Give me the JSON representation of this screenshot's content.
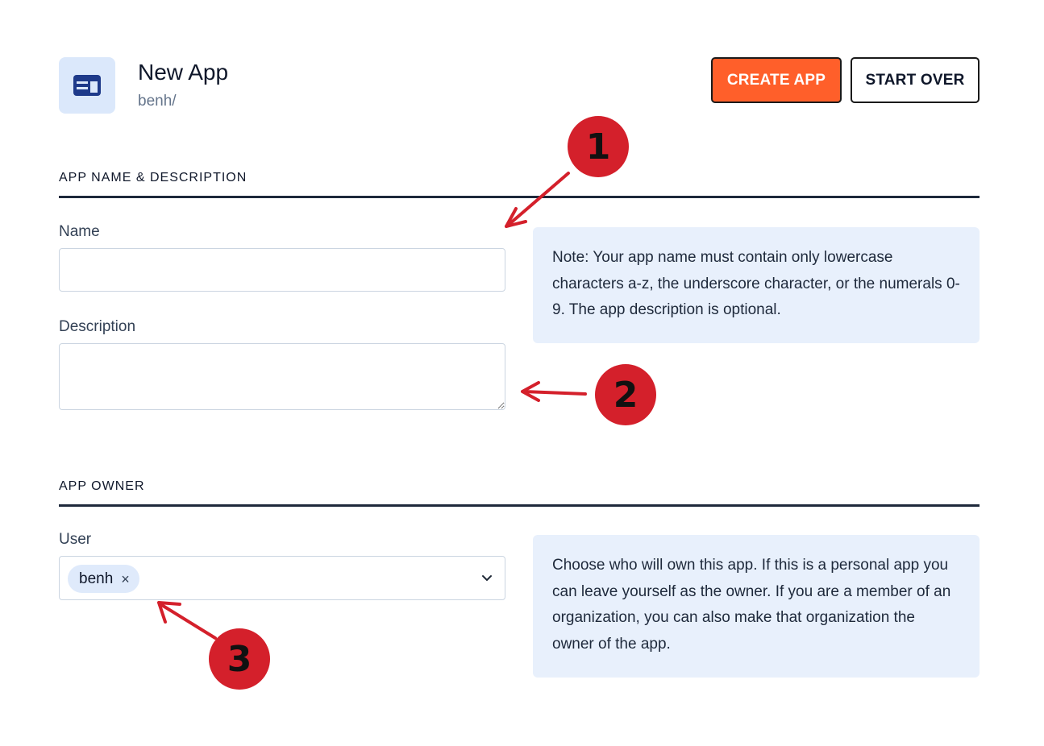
{
  "header": {
    "title": "New App",
    "subtitle": "benh/",
    "create_button": "CREATE APP",
    "start_over_button": "START OVER"
  },
  "section_name": {
    "heading": "APP NAME & DESCRIPTION",
    "name_label": "Name",
    "name_value": "",
    "description_label": "Description",
    "description_value": "",
    "note": "Note: Your app name must contain only lowercase characters a-z, the underscore character, or the numerals 0-9. The app description is optional."
  },
  "section_owner": {
    "heading": "APP OWNER",
    "user_label": "User",
    "selected_user": "benh",
    "remove_symbol": "×",
    "note": "Choose who will own this app. If this is a personal app you can leave yourself as the owner. If you are a member of an organization, you can also make that organization the owner of the app."
  },
  "annotations": [
    "1",
    "2",
    "3"
  ],
  "colors": {
    "accent": "#ff5f2a",
    "icon_bg": "#dbe8fb",
    "note_bg": "#e8f0fc",
    "annotation_red": "#d4202b"
  },
  "icons": {
    "app": "app-window-icon",
    "chevron": "chevron-down-icon",
    "remove": "close-icon"
  }
}
